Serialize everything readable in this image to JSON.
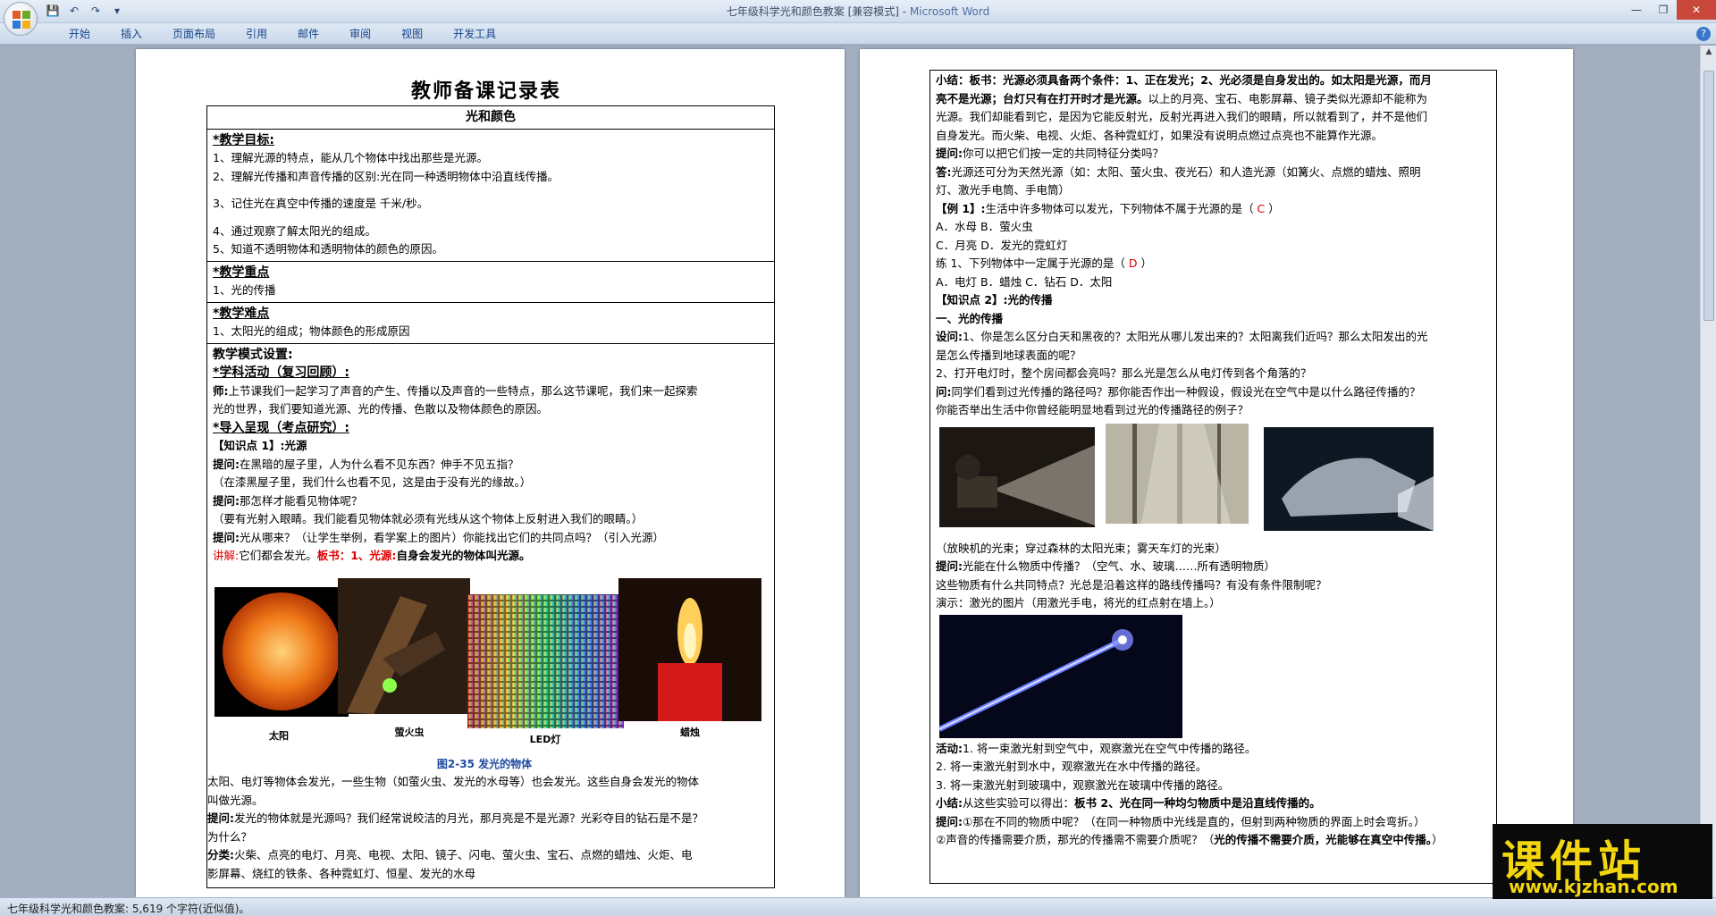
{
  "window": {
    "title": "七年级科学光和颜色教案 [兼容模式] - ",
    "app": "Microsoft Word"
  },
  "qat": {
    "save": "💾",
    "undo": "↶",
    "redo": "↷",
    "more": "▾"
  },
  "window_controls": {
    "minimize": "—",
    "maximize": "❐",
    "close": "✕"
  },
  "menu": [
    "开始",
    "插入",
    "页面布局",
    "引用",
    "邮件",
    "审阅",
    "视图",
    "开发工具"
  ],
  "help": "?",
  "status": {
    "text": "七年级科学光和颜色教案: 5,619 个字符(近似值)。"
  },
  "page1": {
    "doc_title": "教师备课记录表",
    "table_title": "光和颜色",
    "goals_heading": "*教学目标:",
    "goals": [
      "1、理解光源的特点，能从几个物体中找出那些是光源。",
      "2、理解光传播和声音传播的区别:光在同一种透明物体中沿直线传播。",
      "3、记住光在真空中传播的速度是            千米/秒。",
      "4、通过观察了解太阳光的组成。",
      "5、知道不透明物体和透明物体的颜色的原因。"
    ],
    "key_heading": "*教学重点",
    "key_points": [
      "1、光的传播"
    ],
    "difficulty_heading": "*教学难点",
    "difficulties": [
      "1、太阳光的组成；物体颜色的形成原因"
    ],
    "mode_heading": "教学模式设置:",
    "activity_heading": "*学科活动（复习回顾）:",
    "teacher_prefix": "师:",
    "teacher_text": "上节课我们一起学习了声音的产生、传播以及声音的一些特点，那么这节课呢，我们来一起探索",
    "teacher_text2": "光的世界，我们要知道光源、光的传播、色散以及物体颜色的原因。",
    "intro_heading": "*导入呈现（考点研究）:",
    "kp1": "【知识点 1】:光源",
    "q1_prefix": "提问:",
    "q1": "在黑暗的屋子里，人为什么看不见东西？伸手不见五指？",
    "a1": "（在漆黑屋子里，我们什么也看不见，这是由于没有光的缘故。）",
    "q2_prefix": "提问:",
    "q2": "那怎样才能看见物体呢？",
    "a2": "（要有光射入眼睛。我们能看见物体就必须有光线从这个物体上反射进入我们的眼睛。）",
    "q3_prefix": "提问:",
    "q3": "光从哪来？（让学生举例，看学案上的图片）你能找出它们的共同点吗？（引入光源）",
    "explain_prefix": "讲解:",
    "explain_text": "它们都会发光。",
    "board_text": "板书：1、光源:",
    "board_def": "自身会发光的物体叫光源。",
    "photo_labels": [
      "太阳",
      "萤火虫",
      "LED灯",
      "蜡烛"
    ],
    "figure_caption": "图2-35   发光的物体",
    "after1": "太阳、电灯等物体会发光，一些生物（如萤火虫、发光的水母等）也会发光。这些自身会发光的物体",
    "after2": "叫做光源。",
    "q4_prefix": "提问:",
    "q4": "发光的物体就是光源吗？我们经常说皎洁的月光，那月亮是不是光源？光彩夺目的钻石是不是？",
    "q4b": "为什么？",
    "cls_prefix": "分类:",
    "cls": "火柴、点亮的电灯、月亮、电视、太阳、镜子、闪电、萤火虫、宝石、点燃的蜡烛、火炬、电",
    "cls2": "影屏幕、烧红的铁条、各种霓虹灯、恒星、发光的水母"
  },
  "page2": {
    "sum_prefix": "小结：板书：",
    "sum1": "光源必须具备两个条件：1、正在发光；2、光必须是自身发出的。如太阳是光源，而月",
    "sum2": "亮不是光源；台灯只有在打开时才是光源。",
    "sum2b": "以上的月亮、宝石、电影屏幕、镜子类似光源却不能称为",
    "sum3": "光源。我们却能看到它，是因为它能反射光，反射光再进入我们的眼睛，所以就看到了，并不是他们",
    "sum4": "自身发光。而火柴、电视、火炬、各种霓虹灯，如果没有说明点燃过点亮也不能算作光源。",
    "q5_prefix": "提问:",
    "q5": "你可以把它们按一定的共同特征分类吗？",
    "ans_prefix": "答:",
    "ans1": "光源还可分为天然光源（如：太阳、萤火虫、夜光石）和人造光源（如篝火、点燃的蜡烛、照明",
    "ans2": "灯、激光手电筒、手电筒）",
    "ex1_prefix": "【例 1】:",
    "ex1": "生活中许多物体可以发光，下列物体不属于光源的是（  ",
    "ex1_answer": "C",
    "ex1_end": "  ）",
    "ex1_optA": "A．水母      B．萤火虫",
    "ex1_optC": "C．月亮      D．发光的霓虹灯",
    "pr1": "练 1、下列物体中一定属于光源的是（  ",
    "pr1_answer": "D",
    "pr1_end": "  ）",
    "pr1_opts": "A．电灯 B．蜡烛 C．钻石 D．太阳",
    "kp2": "【知识点 2】:光的传播",
    "sec1": "一、光的传播",
    "s1_prefix": "设问:",
    "s1": "1、你是怎么区分白天和黑夜的？太阳光从哪儿发出来的？太阳离我们近吗？那么太阳发出的光",
    "s1b": "是怎么传播到地球表面的呢？",
    "s2": "2、打开电灯时，整个房间都会亮吗？那么光是怎么从电灯传到各个角落的？",
    "q6_prefix": "问:",
    "q6": "同学们看到过光传播的路径吗？那你能否作出一种假设，假设光在空气中是以什么路径传播的？",
    "q6b": "你能否举出生活中你曾经能明显地看到过光的传播路径的例子？",
    "photo_caption": "（放映机的光束；穿过森林的太阳光束；雾天车灯的光束）",
    "q7_prefix": "提问:",
    "q7": "光能在什么物质中传播？（空气、水、玻璃……所有透明物质）",
    "q8": "这些物质有什么共同特点？光总是沿着这样的路线传播吗？有没有条件限制呢？",
    "demo": "演示：激光的图片（用激光手电，将光的红点射在墙上。）",
    "act_prefix": "活动:",
    "act1": "1. 将一束激光射到空气中，观察激光在空气中传播的路径。",
    "act2": "2. 将一束激光射到水中，观察激光在水中传播的路径。",
    "act3": "3. 将一束激光射到玻璃中，观察激光在玻璃中传播的路径。",
    "sum5_prefix": "小结:",
    "sum5": "从这些实验可以得出：",
    "sum5_bold": "板书 2、光在同一种均匀物质中是沿直线传播的。",
    "q9_prefix": "提问:",
    "q9": "①那在不同的物质中呢？（在同一种物质中光线是直的，但射到两种物质的界面上时会弯折。）",
    "q10": "②声音的传播需要介质，那光的传播需不需要介质呢？（",
    "q10_bold": "光的传播不需要介质，光能够在真空中传播。",
    "q10_end": "）"
  },
  "watermark": {
    "cn": "课件站",
    "url": "www.kjzhan.com"
  },
  "colors": {
    "accent": "#15428b",
    "answer": "#e00000",
    "caption": "#1f4aa0",
    "watermark": "#f3d60f"
  }
}
